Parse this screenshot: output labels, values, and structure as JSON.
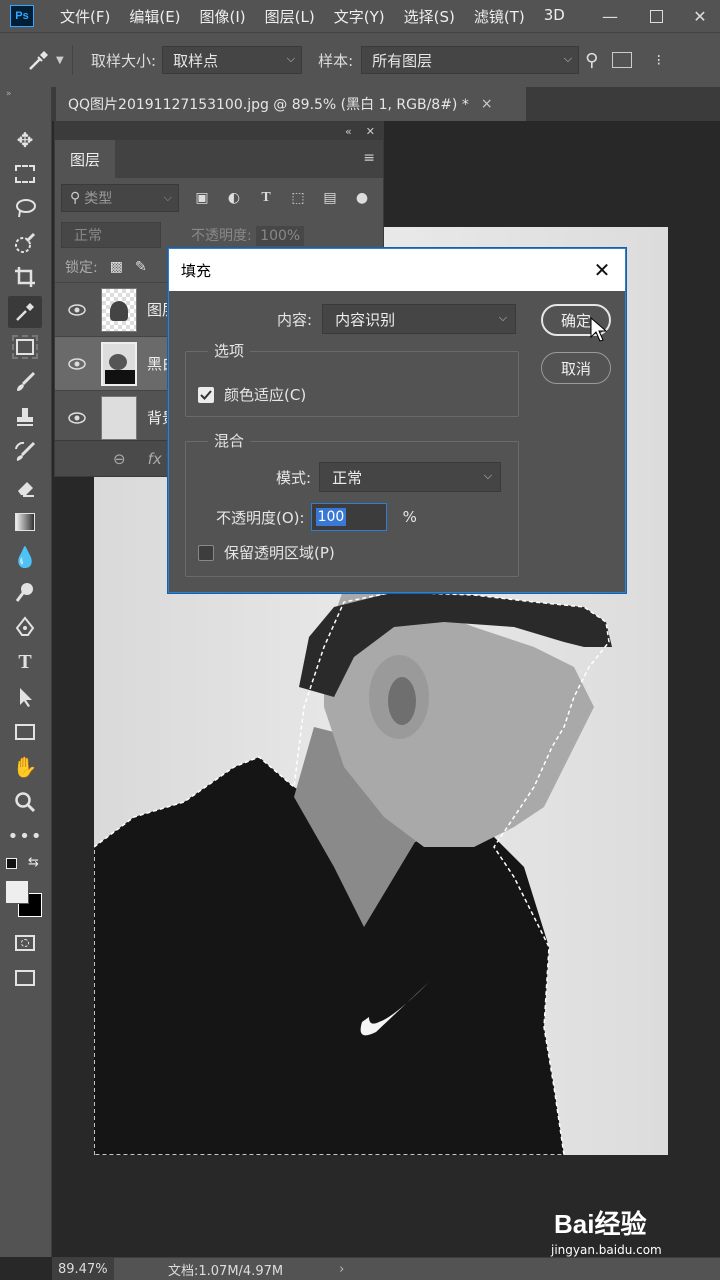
{
  "app": {
    "logo": "Ps",
    "menu": [
      "文件(F)",
      "编辑(E)",
      "图像(I)",
      "图层(L)",
      "文字(Y)",
      "选择(S)",
      "滤镜(T)",
      "3D"
    ]
  },
  "options_bar": {
    "sample_size_label": "取样大小:",
    "sample_size_value": "取样点",
    "sample_label": "样本:",
    "sample_value": "所有图层"
  },
  "document": {
    "tab_title": "QQ图片20191127153100.jpg @ 89.5% (黑白 1, RGB/8#) *",
    "close": "×"
  },
  "layers_panel": {
    "tab": "图层",
    "filter_kind": "类型",
    "blend_mode": "正常",
    "opacity_label": "不透明度:",
    "opacity_value": "100%",
    "lock_label": "锁定:",
    "layers": [
      {
        "name": "图层"
      },
      {
        "name": "黑白"
      },
      {
        "name": "背景"
      }
    ],
    "fx": "fx"
  },
  "fill_dialog": {
    "title": "填充",
    "content_label": "内容:",
    "content_value": "内容识别",
    "options_group": "选项",
    "color_adaptation_label": "颜色适应(C)",
    "color_adaptation_checked": true,
    "blending_group": "混合",
    "mode_label": "模式:",
    "mode_value": "正常",
    "opacity_label": "不透明度(O):",
    "opacity_value": "100",
    "opacity_unit": "%",
    "preserve_transparency_label": "保留透明区域(P)",
    "preserve_transparency_checked": false,
    "ok_button": "确定",
    "cancel_button": "取消"
  },
  "status_bar": {
    "zoom": "89.47%",
    "doc_info": "文档:1.07M/4.97M",
    "arrow": "›"
  },
  "watermark": {
    "logo": "Bai经验",
    "url": "jingyan.baidu.com"
  }
}
